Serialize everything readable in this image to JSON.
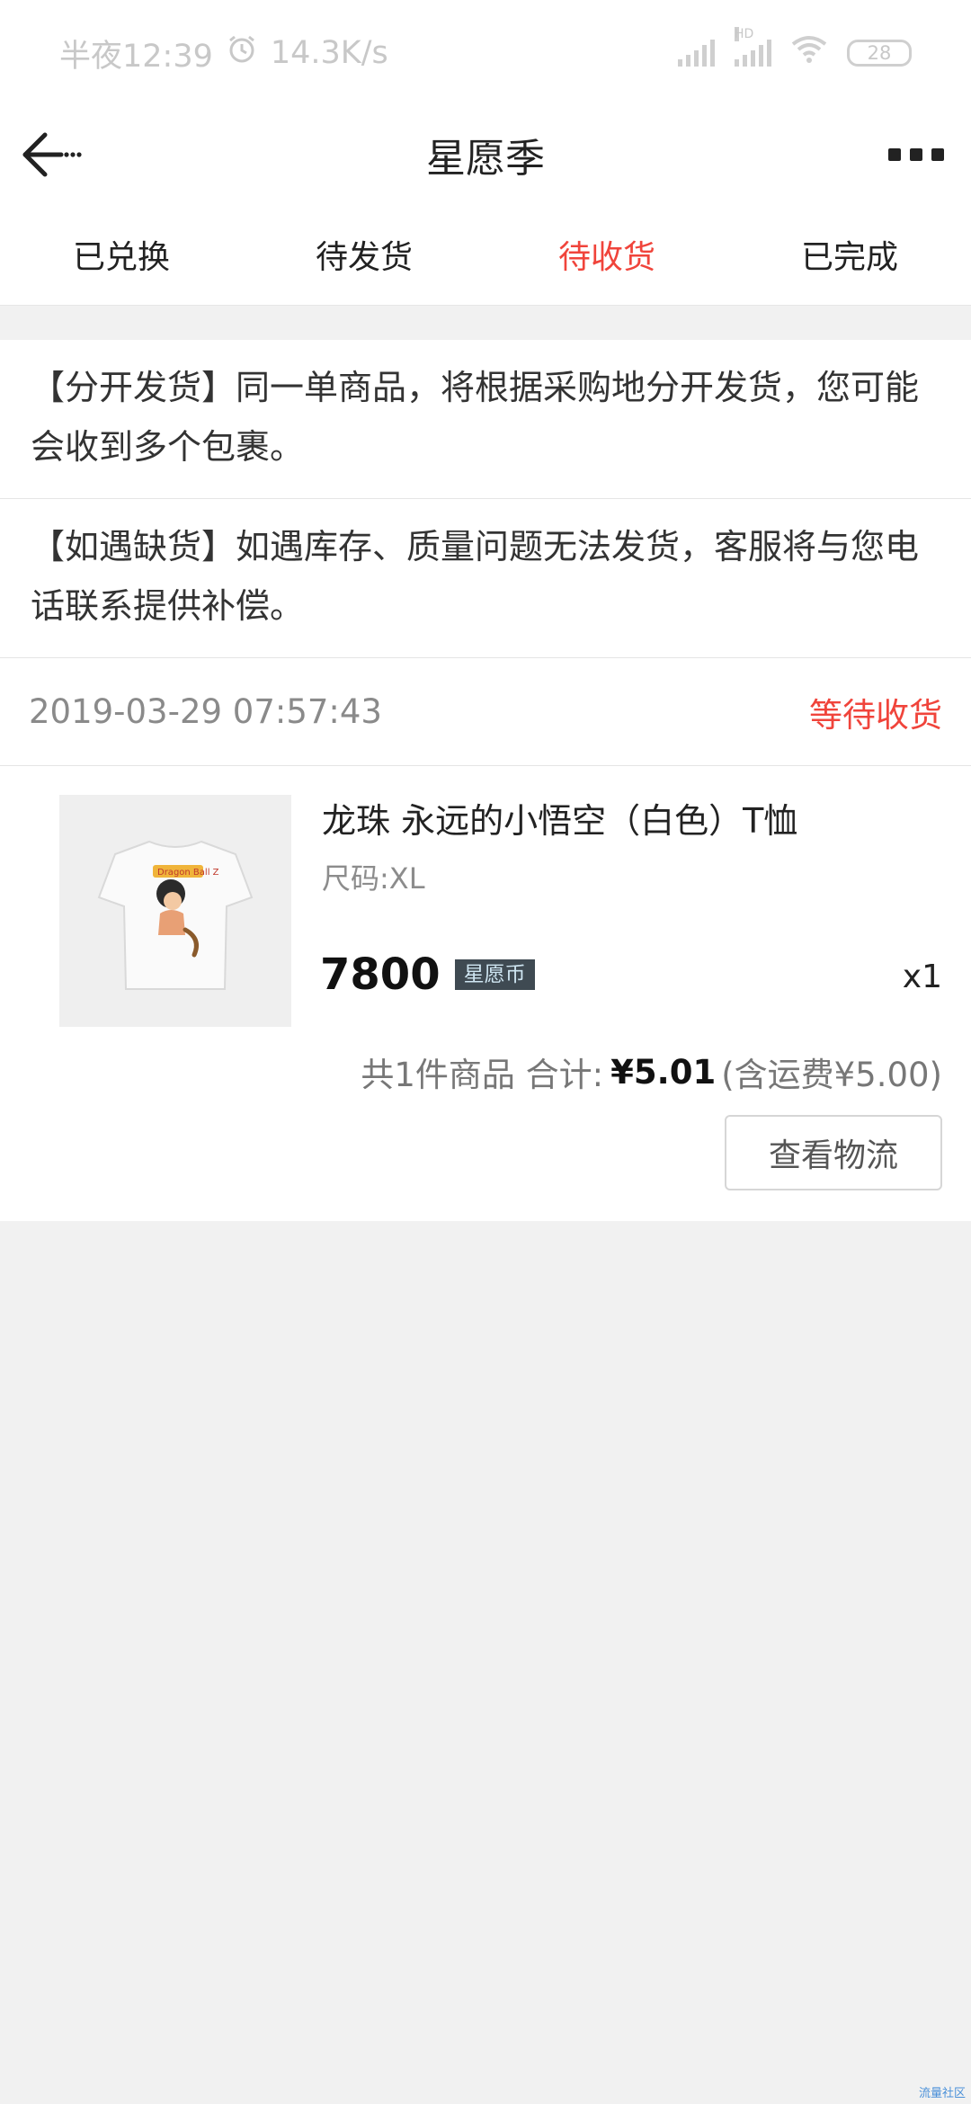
{
  "status_bar": {
    "time": "半夜12:39",
    "speed": "14.3K/s",
    "hd_label": "HD",
    "battery": "28",
    "icons": [
      "alarm-icon",
      "signal-icon",
      "signal-hd-icon",
      "wifi-icon",
      "battery-icon"
    ]
  },
  "nav": {
    "title": "星愿季",
    "back_icon": "back-arrow-icon",
    "more_icon": "more-icon"
  },
  "tabs": [
    {
      "label": "已兑换",
      "active": false
    },
    {
      "label": "待发货",
      "active": false
    },
    {
      "label": "待收货",
      "active": true
    },
    {
      "label": "已完成",
      "active": false
    }
  ],
  "notices": [
    {
      "text": "【分开发货】同一单商品，将根据采购地分开发货，您可能会收到多个包裹。"
    },
    {
      "text": "【如遇缺货】如遇库存、质量问题无法发货，客服将与您电话联系提供补偿。"
    }
  ],
  "order": {
    "time": "2019-03-29 07:57:43",
    "status": "等待收货",
    "item": {
      "title": "龙珠 永远的小悟空（白色）T恤",
      "spec": "尺码:XL",
      "price": "7800",
      "currency_badge": "星愿币",
      "qty": "x1",
      "thumb_print_text": "Dragon Ball Z"
    },
    "summary": {
      "count_text": "共1件商品 合计:",
      "amount": "¥5.01",
      "shipping": "(含运费¥5.00)"
    },
    "track_button": "查看物流"
  },
  "colors": {
    "accent": "#f0443b",
    "badge_bg": "#3f4a52",
    "background": "#f1f1f1"
  },
  "watermark": "流量社区"
}
